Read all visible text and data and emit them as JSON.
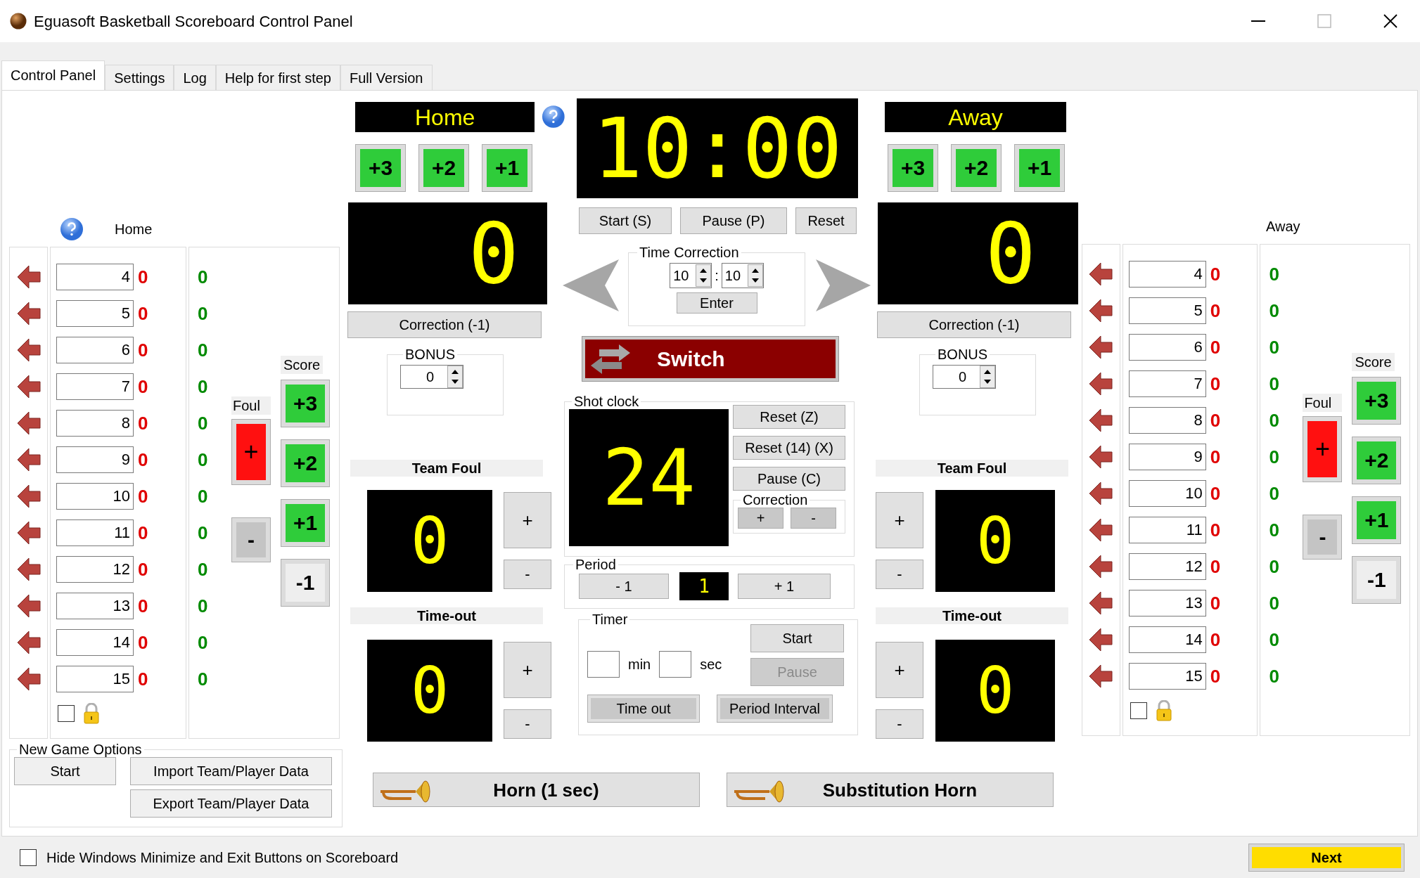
{
  "window": {
    "title": "Eguasoft Basketball Scoreboard Control Panel"
  },
  "tabs": [
    {
      "label": "Control Panel",
      "selected": true
    },
    {
      "label": "Settings",
      "selected": false
    },
    {
      "label": "Log",
      "selected": false
    },
    {
      "label": "Help for first step",
      "selected": false
    },
    {
      "label": "Full Version",
      "selected": false
    }
  ],
  "rosters": [
    {
      "kind": "home",
      "label": "Home",
      "players": [
        {
          "number": "4",
          "fouls": "0",
          "points": "0"
        },
        {
          "number": "5",
          "fouls": "0",
          "points": "0"
        },
        {
          "number": "6",
          "fouls": "0",
          "points": "0"
        },
        {
          "number": "7",
          "fouls": "0",
          "points": "0"
        },
        {
          "number": "8",
          "fouls": "0",
          "points": "0"
        },
        {
          "number": "9",
          "fouls": "0",
          "points": "0"
        },
        {
          "number": "10",
          "fouls": "0",
          "points": "0"
        },
        {
          "number": "11",
          "fouls": "0",
          "points": "0"
        },
        {
          "number": "12",
          "fouls": "0",
          "points": "0"
        },
        {
          "number": "13",
          "fouls": "0",
          "points": "0"
        },
        {
          "number": "14",
          "fouls": "0",
          "points": "0"
        },
        {
          "number": "15",
          "fouls": "0",
          "points": "0"
        }
      ],
      "lock_checked": false,
      "foul": {
        "label": "Foul",
        "add": "+",
        "remove": "-"
      },
      "score": {
        "label": "Score",
        "buttons": [
          {
            "label": "+3",
            "kind": "add"
          },
          {
            "label": "+2",
            "kind": "add"
          },
          {
            "label": "+1",
            "kind": "add"
          },
          {
            "label": "-1",
            "kind": "subtract"
          }
        ]
      }
    },
    {
      "kind": "away",
      "label": "Away",
      "players": [
        {
          "number": "4",
          "fouls": "0",
          "points": "0"
        },
        {
          "number": "5",
          "fouls": "0",
          "points": "0"
        },
        {
          "number": "6",
          "fouls": "0",
          "points": "0"
        },
        {
          "number": "7",
          "fouls": "0",
          "points": "0"
        },
        {
          "number": "8",
          "fouls": "0",
          "points": "0"
        },
        {
          "number": "9",
          "fouls": "0",
          "points": "0"
        },
        {
          "number": "10",
          "fouls": "0",
          "points": "0"
        },
        {
          "number": "11",
          "fouls": "0",
          "points": "0"
        },
        {
          "number": "12",
          "fouls": "0",
          "points": "0"
        },
        {
          "number": "13",
          "fouls": "0",
          "points": "0"
        },
        {
          "number": "14",
          "fouls": "0",
          "points": "0"
        },
        {
          "number": "15",
          "fouls": "0",
          "points": "0"
        }
      ],
      "lock_checked": false,
      "foul": {
        "label": "Foul",
        "add": "+",
        "remove": "-"
      },
      "score": {
        "label": "Score",
        "buttons": [
          {
            "label": "+3",
            "kind": "add"
          },
          {
            "label": "+2",
            "kind": "add"
          },
          {
            "label": "+1",
            "kind": "add"
          },
          {
            "label": "-1",
            "kind": "subtract"
          }
        ]
      }
    }
  ],
  "new_game_options": {
    "title": "New Game Options",
    "buttons": [
      "Start",
      "Import Team/Player Data",
      "Export Team/Player Data"
    ]
  },
  "teams": [
    {
      "kind": "home",
      "name": "Home",
      "score_buttons": [
        "+3",
        "+2",
        "+1"
      ],
      "score": "0",
      "correction": "Correction (-1)",
      "bonus": {
        "label": "BONUS",
        "value": "0"
      },
      "team_foul": {
        "label": "Team Foul",
        "value": "0",
        "add": "+",
        "remove": "-"
      },
      "timeout": {
        "label": "Time-out",
        "value": "0",
        "add": "+",
        "remove": "-"
      }
    },
    {
      "kind": "away",
      "name": "Away",
      "score_buttons": [
        "+3",
        "+2",
        "+1"
      ],
      "score": "0",
      "correction": "Correction (-1)",
      "bonus": {
        "label": "BONUS",
        "value": "0"
      },
      "team_foul": {
        "label": "Team Foul",
        "value": "0",
        "add": "+",
        "remove": "-"
      },
      "timeout": {
        "label": "Time-out",
        "value": "0",
        "add": "+",
        "remove": "-"
      }
    }
  ],
  "clock": {
    "time": "10:00",
    "buttons": [
      "Start (S)",
      "Pause (P)",
      "Reset"
    ]
  },
  "time_correction": {
    "title": "Time Correction",
    "minutes": "10",
    "separator": ":",
    "seconds": "10",
    "enter": "Enter"
  },
  "switch": {
    "label": "Switch"
  },
  "shot_clock": {
    "title": "Shot clock",
    "value": "24",
    "buttons": [
      "Reset (Z)",
      "Reset (14) (X)",
      "Pause (C)"
    ],
    "correction": {
      "title": "Correction",
      "add": "+",
      "remove": "-"
    }
  },
  "period": {
    "title": "Period",
    "decrease": "- 1",
    "value": "1",
    "increase": "+ 1"
  },
  "timer": {
    "title": "Timer",
    "min_label": "min",
    "sec_label": "sec",
    "buttons": [
      {
        "label": "Start",
        "disabled": false
      },
      {
        "label": "Pause",
        "disabled": true
      },
      {
        "label": "Time out",
        "disabled": false
      },
      {
        "label": "Period Interval",
        "disabled": false
      }
    ]
  },
  "horns": [
    "Horn (1 sec)",
    "Substitution Horn"
  ],
  "footer": {
    "hide_buttons": {
      "label": "Hide Windows Minimize and Exit Buttons on Scoreboard",
      "checked": false
    },
    "next": "Next"
  }
}
